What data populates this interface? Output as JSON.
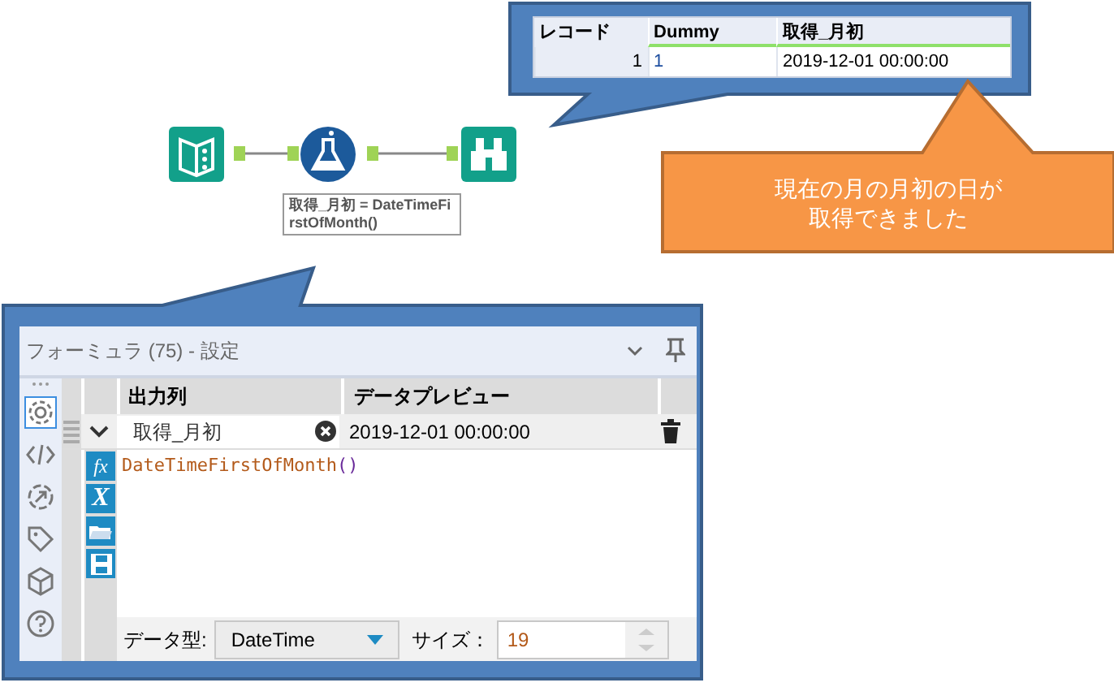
{
  "preview_table": {
    "columns": [
      "レコード",
      "Dummy",
      "取得_月初"
    ],
    "rows": [
      [
        "1",
        "1",
        "2019-12-01 00:00:00"
      ]
    ]
  },
  "workflow": {
    "tools": [
      {
        "kind": "input"
      },
      {
        "kind": "formula"
      },
      {
        "kind": "browse"
      }
    ],
    "annotation": "取得_月初 = DateTimeFirstOfMonth()"
  },
  "note": [
    "現在の月の月初の日が",
    "取得できました"
  ],
  "panel": {
    "title": "フォーミュラ (75) - 設定",
    "side_icons": [
      {
        "kind": "settings",
        "selected": true
      },
      {
        "kind": "code",
        "selected": false
      },
      {
        "kind": "output",
        "selected": false
      },
      {
        "kind": "tag",
        "selected": false
      },
      {
        "kind": "cube",
        "selected": false
      },
      {
        "kind": "help",
        "selected": false
      }
    ],
    "columns": [
      "出力列",
      "データプレビュー"
    ],
    "row": {
      "output_column": "取得_月初",
      "preview": "2019-12-01 00:00:00"
    },
    "editor_buttons": [
      {
        "kind": "function",
        "glyph": "fx"
      },
      {
        "kind": "variable",
        "glyph": "X"
      },
      {
        "kind": "open"
      },
      {
        "kind": "save"
      }
    ],
    "formula": [
      {
        "kind": "function",
        "text": "DateTimeFirstOfMonth"
      },
      {
        "kind": "paren",
        "text": "()"
      }
    ],
    "data_type": {
      "label": "データ型:",
      "value": "DateTime"
    },
    "size": {
      "label": "サイズ：",
      "value": "19"
    }
  }
}
